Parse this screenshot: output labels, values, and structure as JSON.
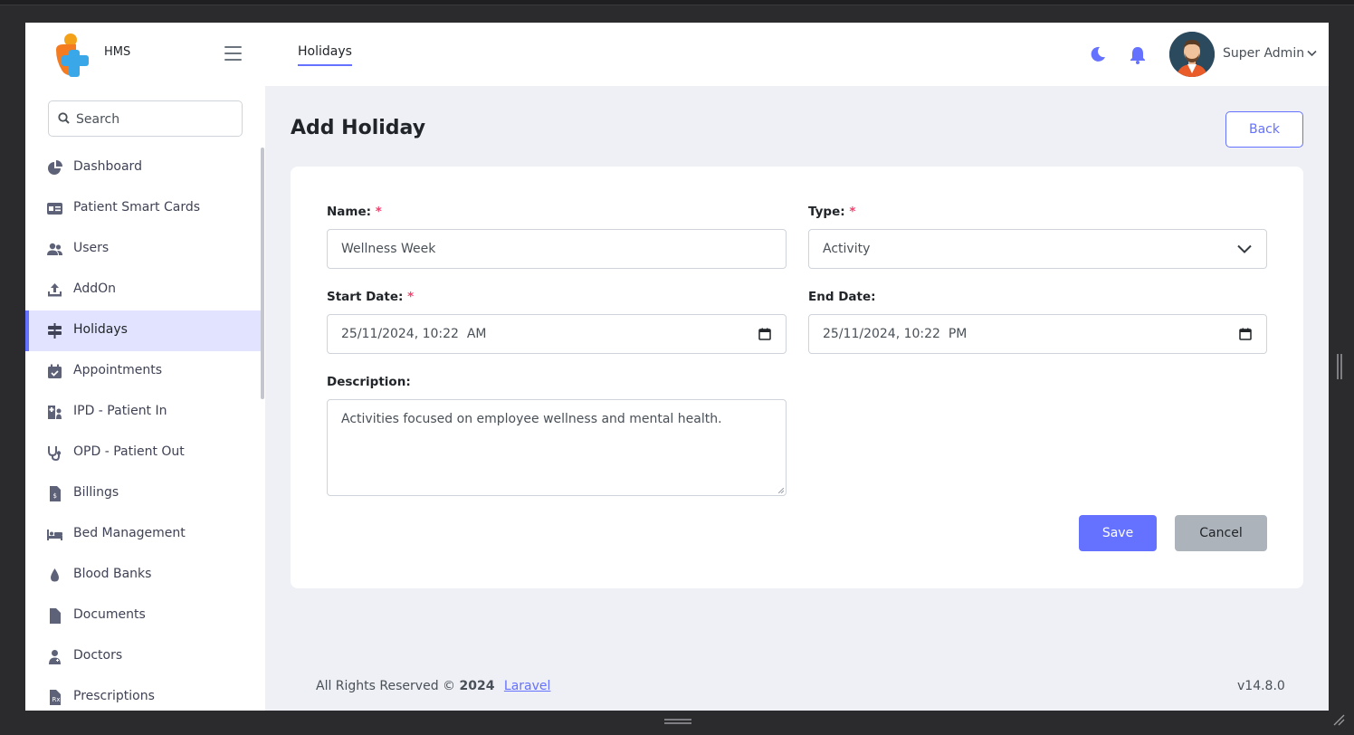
{
  "brand": {
    "name": "HMS"
  },
  "header": {
    "tab": "Holidays",
    "user_name": "Super Admin"
  },
  "search": {
    "placeholder": "Search"
  },
  "sidebar": {
    "items": [
      {
        "label": "Dashboard",
        "icon": "pie-chart-icon"
      },
      {
        "label": "Patient Smart Cards",
        "icon": "id-card-icon"
      },
      {
        "label": "Users",
        "icon": "users-icon"
      },
      {
        "label": "AddOn",
        "icon": "upload-icon"
      },
      {
        "label": "Holidays",
        "icon": "signpost-icon",
        "active": true
      },
      {
        "label": "Appointments",
        "icon": "calendar-check-icon"
      },
      {
        "label": "IPD - Patient In",
        "icon": "hospital-user-icon"
      },
      {
        "label": "OPD - Patient Out",
        "icon": "stethoscope-icon"
      },
      {
        "label": "Billings",
        "icon": "invoice-icon"
      },
      {
        "label": "Bed Management",
        "icon": "bed-icon"
      },
      {
        "label": "Blood Banks",
        "icon": "blood-drop-icon"
      },
      {
        "label": "Documents",
        "icon": "file-icon"
      },
      {
        "label": "Doctors",
        "icon": "doctor-icon"
      },
      {
        "label": "Prescriptions",
        "icon": "prescription-icon"
      }
    ]
  },
  "page": {
    "title": "Add Holiday",
    "back_label": "Back"
  },
  "form": {
    "name_label": "Name:",
    "name_value": "Wellness Week",
    "type_label": "Type:",
    "type_value": "Activity",
    "start_label": "Start Date:",
    "start_value": "25/11/2024, 10:22  AM",
    "end_label": "End Date:",
    "end_value": "25/11/2024, 10:22  PM",
    "description_label": "Description:",
    "description_value": "Activities focused on employee wellness and mental health.",
    "required_mark": "*",
    "save_label": "Save",
    "cancel_label": "Cancel"
  },
  "footer": {
    "rights": "All Rights Reserved ©",
    "year": "2024",
    "link": "Laravel",
    "version": "v14.8.0"
  },
  "colors": {
    "accent": "#6571ff",
    "required": "#f1416c",
    "active_bg": "#e2e4ff"
  }
}
